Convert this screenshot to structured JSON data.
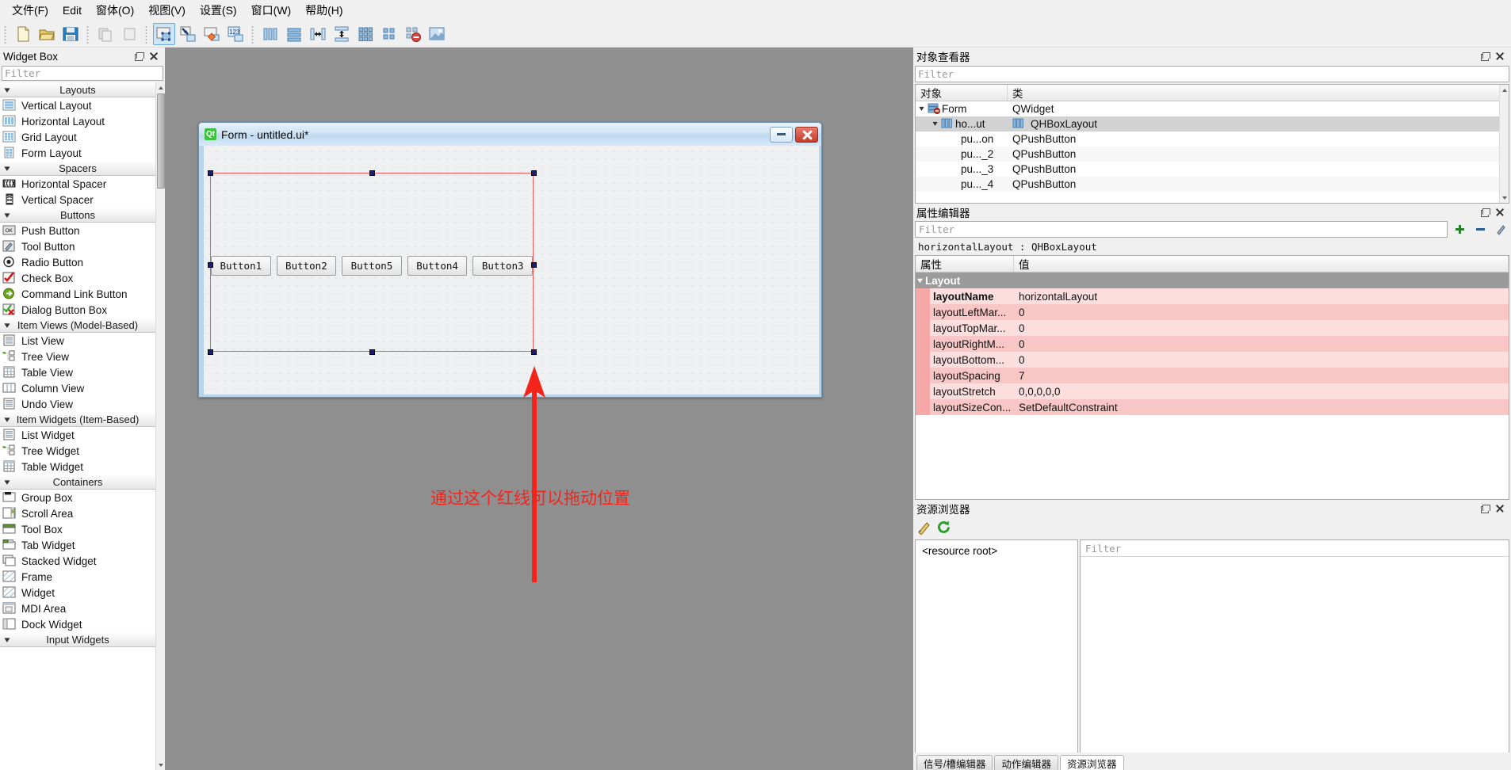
{
  "menubar": {
    "items": [
      {
        "label": "文件(F)",
        "accel": "F"
      },
      {
        "label": "Edit",
        "accel": "E"
      },
      {
        "label": "窗体(O)",
        "accel": "O"
      },
      {
        "label": "视图(V)",
        "accel": "V"
      },
      {
        "label": "设置(S)",
        "accel": "S"
      },
      {
        "label": "窗口(W)",
        "accel": "W"
      },
      {
        "label": "帮助(H)",
        "accel": "H"
      }
    ]
  },
  "toolbar": {
    "groups": [
      {
        "buttons": [
          {
            "name": "new-form-icon",
            "label": "New"
          },
          {
            "name": "open-form-icon",
            "label": "Open"
          },
          {
            "name": "save-form-icon",
            "label": "Save"
          }
        ]
      },
      {
        "buttons": [
          {
            "name": "copy-icon",
            "label": "Copy"
          },
          {
            "name": "paste-icon",
            "label": "Paste"
          }
        ]
      },
      {
        "buttons": [
          {
            "name": "edit-widgets-icon",
            "label": "Edit Widgets",
            "active": true
          },
          {
            "name": "edit-signals-slots-icon",
            "label": "Edit Signals/Slots"
          },
          {
            "name": "edit-buddies-icon",
            "label": "Edit Buddies"
          },
          {
            "name": "edit-tab-order-icon",
            "label": "Edit Tab Order"
          }
        ]
      },
      {
        "buttons": [
          {
            "name": "layout-horizontally-icon",
            "label": "Lay Out Horizontally"
          },
          {
            "name": "layout-vertically-icon",
            "label": "Lay Out Vertically"
          },
          {
            "name": "layout-splitter-horizontal-icon",
            "label": "Lay Out Horizontally in Splitter"
          },
          {
            "name": "layout-splitter-vertical-icon",
            "label": "Lay Out Vertically in Splitter"
          },
          {
            "name": "layout-grid-icon",
            "label": "Lay Out in a Grid"
          },
          {
            "name": "layout-form-icon",
            "label": "Lay Out in a Form Layout"
          },
          {
            "name": "break-layout-icon",
            "label": "Break Layout"
          },
          {
            "name": "adjust-size-icon",
            "label": "Adjust Size"
          }
        ]
      }
    ]
  },
  "widget_box": {
    "title": "Widget Box",
    "filter_placeholder": "Filter",
    "groups": [
      {
        "title": "Layouts",
        "items": [
          {
            "label": "Vertical Layout",
            "icon": "vertical-layout-icon"
          },
          {
            "label": "Horizontal Layout",
            "icon": "horizontal-layout-icon"
          },
          {
            "label": "Grid Layout",
            "icon": "grid-layout-icon"
          },
          {
            "label": "Form Layout",
            "icon": "form-layout-icon"
          }
        ]
      },
      {
        "title": "Spacers",
        "items": [
          {
            "label": "Horizontal Spacer",
            "icon": "horizontal-spacer-icon"
          },
          {
            "label": "Vertical Spacer",
            "icon": "vertical-spacer-icon"
          }
        ]
      },
      {
        "title": "Buttons",
        "items": [
          {
            "label": "Push Button",
            "icon": "push-button-icon"
          },
          {
            "label": "Tool Button",
            "icon": "tool-button-icon"
          },
          {
            "label": "Radio Button",
            "icon": "radio-button-icon"
          },
          {
            "label": "Check Box",
            "icon": "check-box-icon"
          },
          {
            "label": "Command Link Button",
            "icon": "command-link-button-icon"
          },
          {
            "label": "Dialog Button Box",
            "icon": "dialog-button-box-icon"
          }
        ]
      },
      {
        "title": "Item Views (Model-Based)",
        "items": [
          {
            "label": "List View",
            "icon": "list-view-icon"
          },
          {
            "label": "Tree View",
            "icon": "tree-view-icon"
          },
          {
            "label": "Table View",
            "icon": "table-view-icon"
          },
          {
            "label": "Column View",
            "icon": "column-view-icon"
          },
          {
            "label": "Undo View",
            "icon": "undo-view-icon"
          }
        ]
      },
      {
        "title": "Item Widgets (Item-Based)",
        "items": [
          {
            "label": "List Widget",
            "icon": "list-widget-icon"
          },
          {
            "label": "Tree Widget",
            "icon": "tree-widget-icon"
          },
          {
            "label": "Table Widget",
            "icon": "table-widget-icon"
          }
        ]
      },
      {
        "title": "Containers",
        "items": [
          {
            "label": "Group Box",
            "icon": "group-box-icon"
          },
          {
            "label": "Scroll Area",
            "icon": "scroll-area-icon"
          },
          {
            "label": "Tool Box",
            "icon": "tool-box-icon"
          },
          {
            "label": "Tab Widget",
            "icon": "tab-widget-icon"
          },
          {
            "label": "Stacked Widget",
            "icon": "stacked-widget-icon"
          },
          {
            "label": "Frame",
            "icon": "frame-icon"
          },
          {
            "label": "Widget",
            "icon": "widget-icon"
          },
          {
            "label": "MDI Area",
            "icon": "mdi-area-icon"
          },
          {
            "label": "Dock Widget",
            "icon": "dock-widget-icon"
          }
        ]
      },
      {
        "title": "Input Widgets",
        "items": []
      }
    ]
  },
  "form": {
    "title": "Form - untitled.ui*",
    "logo": "Qt",
    "minimize_label": "",
    "close_label": "",
    "buttons": [
      "Button1",
      "Button2",
      "Button5",
      "Button4",
      "Button3"
    ]
  },
  "annotation": {
    "text": "通过这个红线可以拖动位置",
    "color": "#f2241b"
  },
  "object_inspector": {
    "title": "对象查看器",
    "filter_placeholder": "Filter",
    "columns": [
      "对象",
      "类"
    ],
    "rows": [
      {
        "name": "Form",
        "class": "QWidget",
        "depth": 0,
        "expandable": true,
        "selected": false,
        "icon": "form-widget-icon"
      },
      {
        "name": "ho...ut",
        "class": "QHBoxLayout",
        "depth": 1,
        "expandable": true,
        "selected": true,
        "icon": "hbox-layout-icon"
      },
      {
        "name": "pu...on",
        "class": "QPushButton",
        "depth": 2,
        "expandable": false,
        "selected": false,
        "icon": ""
      },
      {
        "name": "pu..._2",
        "class": "QPushButton",
        "depth": 2,
        "expandable": false,
        "selected": false,
        "icon": ""
      },
      {
        "name": "pu..._3",
        "class": "QPushButton",
        "depth": 2,
        "expandable": false,
        "selected": false,
        "icon": ""
      },
      {
        "name": "pu..._4",
        "class": "QPushButton",
        "depth": 2,
        "expandable": false,
        "selected": false,
        "icon": ""
      }
    ]
  },
  "property_editor": {
    "title": "属性编辑器",
    "filter_placeholder": "Filter",
    "object_signature": "horizontalLayout : QHBoxLayout",
    "columns": [
      "属性",
      "值"
    ],
    "group": "Layout",
    "rows": [
      {
        "name": "layoutName",
        "value": "horizontalLayout",
        "bold": true
      },
      {
        "name": "layoutLeftMar...",
        "value": "0",
        "bold": false
      },
      {
        "name": "layoutTopMar...",
        "value": "0",
        "bold": false
      },
      {
        "name": "layoutRightM...",
        "value": "0",
        "bold": false
      },
      {
        "name": "layoutBottom...",
        "value": "0",
        "bold": false
      },
      {
        "name": "layoutSpacing",
        "value": "7",
        "bold": false
      },
      {
        "name": "layoutStretch",
        "value": "0,0,0,0,0",
        "bold": false
      },
      {
        "name": "layoutSizeCon...",
        "value": "SetDefaultConstraint",
        "bold": false
      }
    ]
  },
  "resource_browser": {
    "title": "资源浏览器",
    "root_label": "<resource root>",
    "filter_placeholder": "Filter",
    "tools": [
      {
        "name": "edit-resources-icon",
        "label": "Edit Resources"
      },
      {
        "name": "reload-icon",
        "label": "Reload"
      }
    ]
  },
  "bottom_tabs": {
    "tabs": [
      {
        "label": "信号/槽编辑器",
        "active": false
      },
      {
        "label": "动作编辑器",
        "active": false
      },
      {
        "label": "资源浏览器",
        "active": true
      }
    ]
  }
}
